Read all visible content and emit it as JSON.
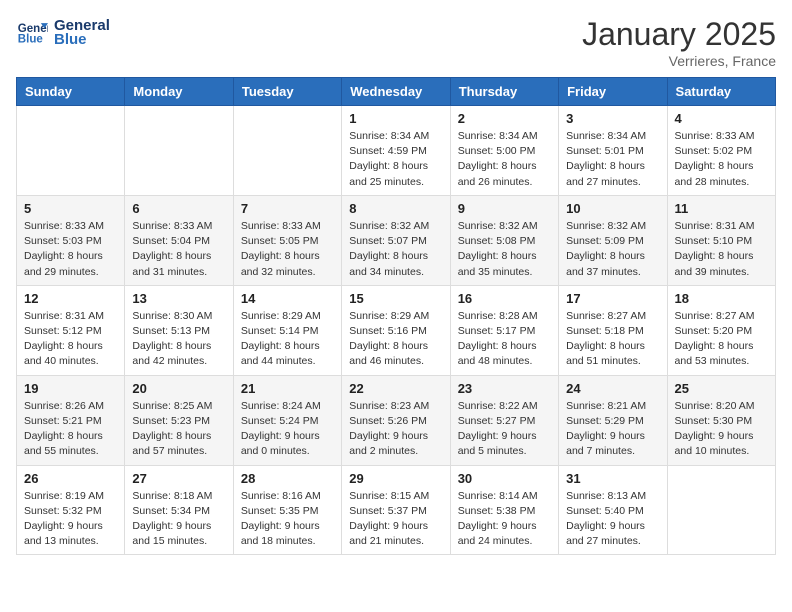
{
  "header": {
    "logo_line1": "General",
    "logo_line2": "Blue",
    "month_title": "January 2025",
    "location": "Verrieres, France"
  },
  "days_of_week": [
    "Sunday",
    "Monday",
    "Tuesday",
    "Wednesday",
    "Thursday",
    "Friday",
    "Saturday"
  ],
  "weeks": [
    [
      {
        "day": "",
        "info": ""
      },
      {
        "day": "",
        "info": ""
      },
      {
        "day": "",
        "info": ""
      },
      {
        "day": "1",
        "info": "Sunrise: 8:34 AM\nSunset: 4:59 PM\nDaylight: 8 hours\nand 25 minutes."
      },
      {
        "day": "2",
        "info": "Sunrise: 8:34 AM\nSunset: 5:00 PM\nDaylight: 8 hours\nand 26 minutes."
      },
      {
        "day": "3",
        "info": "Sunrise: 8:34 AM\nSunset: 5:01 PM\nDaylight: 8 hours\nand 27 minutes."
      },
      {
        "day": "4",
        "info": "Sunrise: 8:33 AM\nSunset: 5:02 PM\nDaylight: 8 hours\nand 28 minutes."
      }
    ],
    [
      {
        "day": "5",
        "info": "Sunrise: 8:33 AM\nSunset: 5:03 PM\nDaylight: 8 hours\nand 29 minutes."
      },
      {
        "day": "6",
        "info": "Sunrise: 8:33 AM\nSunset: 5:04 PM\nDaylight: 8 hours\nand 31 minutes."
      },
      {
        "day": "7",
        "info": "Sunrise: 8:33 AM\nSunset: 5:05 PM\nDaylight: 8 hours\nand 32 minutes."
      },
      {
        "day": "8",
        "info": "Sunrise: 8:32 AM\nSunset: 5:07 PM\nDaylight: 8 hours\nand 34 minutes."
      },
      {
        "day": "9",
        "info": "Sunrise: 8:32 AM\nSunset: 5:08 PM\nDaylight: 8 hours\nand 35 minutes."
      },
      {
        "day": "10",
        "info": "Sunrise: 8:32 AM\nSunset: 5:09 PM\nDaylight: 8 hours\nand 37 minutes."
      },
      {
        "day": "11",
        "info": "Sunrise: 8:31 AM\nSunset: 5:10 PM\nDaylight: 8 hours\nand 39 minutes."
      }
    ],
    [
      {
        "day": "12",
        "info": "Sunrise: 8:31 AM\nSunset: 5:12 PM\nDaylight: 8 hours\nand 40 minutes."
      },
      {
        "day": "13",
        "info": "Sunrise: 8:30 AM\nSunset: 5:13 PM\nDaylight: 8 hours\nand 42 minutes."
      },
      {
        "day": "14",
        "info": "Sunrise: 8:29 AM\nSunset: 5:14 PM\nDaylight: 8 hours\nand 44 minutes."
      },
      {
        "day": "15",
        "info": "Sunrise: 8:29 AM\nSunset: 5:16 PM\nDaylight: 8 hours\nand 46 minutes."
      },
      {
        "day": "16",
        "info": "Sunrise: 8:28 AM\nSunset: 5:17 PM\nDaylight: 8 hours\nand 48 minutes."
      },
      {
        "day": "17",
        "info": "Sunrise: 8:27 AM\nSunset: 5:18 PM\nDaylight: 8 hours\nand 51 minutes."
      },
      {
        "day": "18",
        "info": "Sunrise: 8:27 AM\nSunset: 5:20 PM\nDaylight: 8 hours\nand 53 minutes."
      }
    ],
    [
      {
        "day": "19",
        "info": "Sunrise: 8:26 AM\nSunset: 5:21 PM\nDaylight: 8 hours\nand 55 minutes."
      },
      {
        "day": "20",
        "info": "Sunrise: 8:25 AM\nSunset: 5:23 PM\nDaylight: 8 hours\nand 57 minutes."
      },
      {
        "day": "21",
        "info": "Sunrise: 8:24 AM\nSunset: 5:24 PM\nDaylight: 9 hours\nand 0 minutes."
      },
      {
        "day": "22",
        "info": "Sunrise: 8:23 AM\nSunset: 5:26 PM\nDaylight: 9 hours\nand 2 minutes."
      },
      {
        "day": "23",
        "info": "Sunrise: 8:22 AM\nSunset: 5:27 PM\nDaylight: 9 hours\nand 5 minutes."
      },
      {
        "day": "24",
        "info": "Sunrise: 8:21 AM\nSunset: 5:29 PM\nDaylight: 9 hours\nand 7 minutes."
      },
      {
        "day": "25",
        "info": "Sunrise: 8:20 AM\nSunset: 5:30 PM\nDaylight: 9 hours\nand 10 minutes."
      }
    ],
    [
      {
        "day": "26",
        "info": "Sunrise: 8:19 AM\nSunset: 5:32 PM\nDaylight: 9 hours\nand 13 minutes."
      },
      {
        "day": "27",
        "info": "Sunrise: 8:18 AM\nSunset: 5:34 PM\nDaylight: 9 hours\nand 15 minutes."
      },
      {
        "day": "28",
        "info": "Sunrise: 8:16 AM\nSunset: 5:35 PM\nDaylight: 9 hours\nand 18 minutes."
      },
      {
        "day": "29",
        "info": "Sunrise: 8:15 AM\nSunset: 5:37 PM\nDaylight: 9 hours\nand 21 minutes."
      },
      {
        "day": "30",
        "info": "Sunrise: 8:14 AM\nSunset: 5:38 PM\nDaylight: 9 hours\nand 24 minutes."
      },
      {
        "day": "31",
        "info": "Sunrise: 8:13 AM\nSunset: 5:40 PM\nDaylight: 9 hours\nand 27 minutes."
      },
      {
        "day": "",
        "info": ""
      }
    ]
  ]
}
